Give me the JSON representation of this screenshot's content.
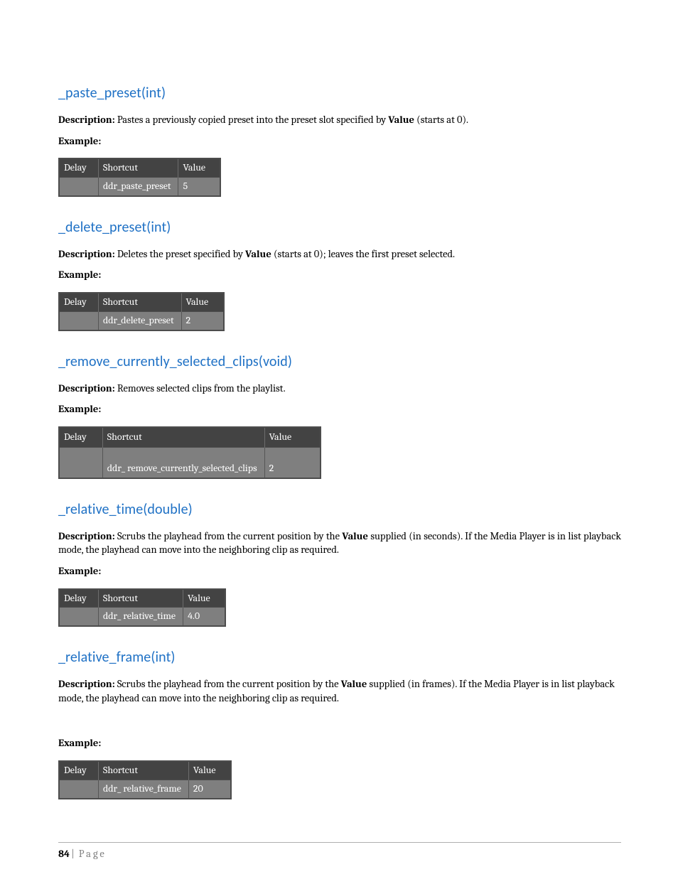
{
  "sections": [
    {
      "title": "_paste_preset(int)",
      "desc_label": "Description:",
      "desc_before": " Pastes a previously copied preset into the preset slot specified by ",
      "desc_bold": "Value",
      "desc_after": " (starts at 0).",
      "example_label": "Example:",
      "table": {
        "headers": [
          "Delay",
          "Shortcut",
          "Value"
        ],
        "row": [
          "",
          "ddr_paste_preset",
          "5"
        ]
      }
    },
    {
      "title": "_delete_preset(int)",
      "desc_label": "Description:",
      "desc_before": " Deletes the preset specified by ",
      "desc_bold": "Value",
      "desc_after": " (starts at 0); leaves the first preset selected.",
      "example_label": "Example:",
      "table": {
        "headers": [
          "Delay",
          "Shortcut",
          "Value"
        ],
        "row": [
          "",
          "ddr_delete_preset",
          "2"
        ]
      }
    },
    {
      "title": "_remove_currently_selected_clips(void)",
      "desc_label": "Description:",
      "desc_before": " Removes selected clips from the playlist.",
      "desc_bold": "",
      "desc_after": "",
      "example_label": "Example:",
      "tall": true,
      "table": {
        "headers": [
          "Delay",
          "Shortcut",
          "Value"
        ],
        "row": [
          "",
          "ddr_ remove_currently_selected_clips",
          "2"
        ]
      }
    },
    {
      "title": "_relative_time(double)",
      "desc_label": "Description:",
      "desc_before": " Scrubs the playhead from the current position by the ",
      "desc_bold": "Value",
      "desc_after": " supplied (in seconds). If the Media Player is in list playback mode, the playhead can move into the neighboring clip as required.",
      "justify": true,
      "example_label": "Example:",
      "table": {
        "headers": [
          "Delay",
          "Shortcut",
          "Value"
        ],
        "row": [
          "",
          "ddr_ relative_time",
          "4.0"
        ]
      }
    },
    {
      "title": "_relative_frame(int)",
      "desc_label": "Description:",
      "desc_before": " Scrubs the playhead from the current position by the ",
      "desc_bold": "Value",
      "desc_after": " supplied (in frames). If the Media Player is in list playback mode, the playhead can move into the neighboring clip as required.",
      "example_label": "Example:",
      "extra_gap": true,
      "table": {
        "headers": [
          "Delay",
          "Shortcut",
          "Value"
        ],
        "row": [
          "",
          "ddr_ relative_frame",
          "20"
        ]
      }
    }
  ],
  "footer": {
    "page_num": "84",
    "pipe": "|",
    "label": "Page"
  }
}
